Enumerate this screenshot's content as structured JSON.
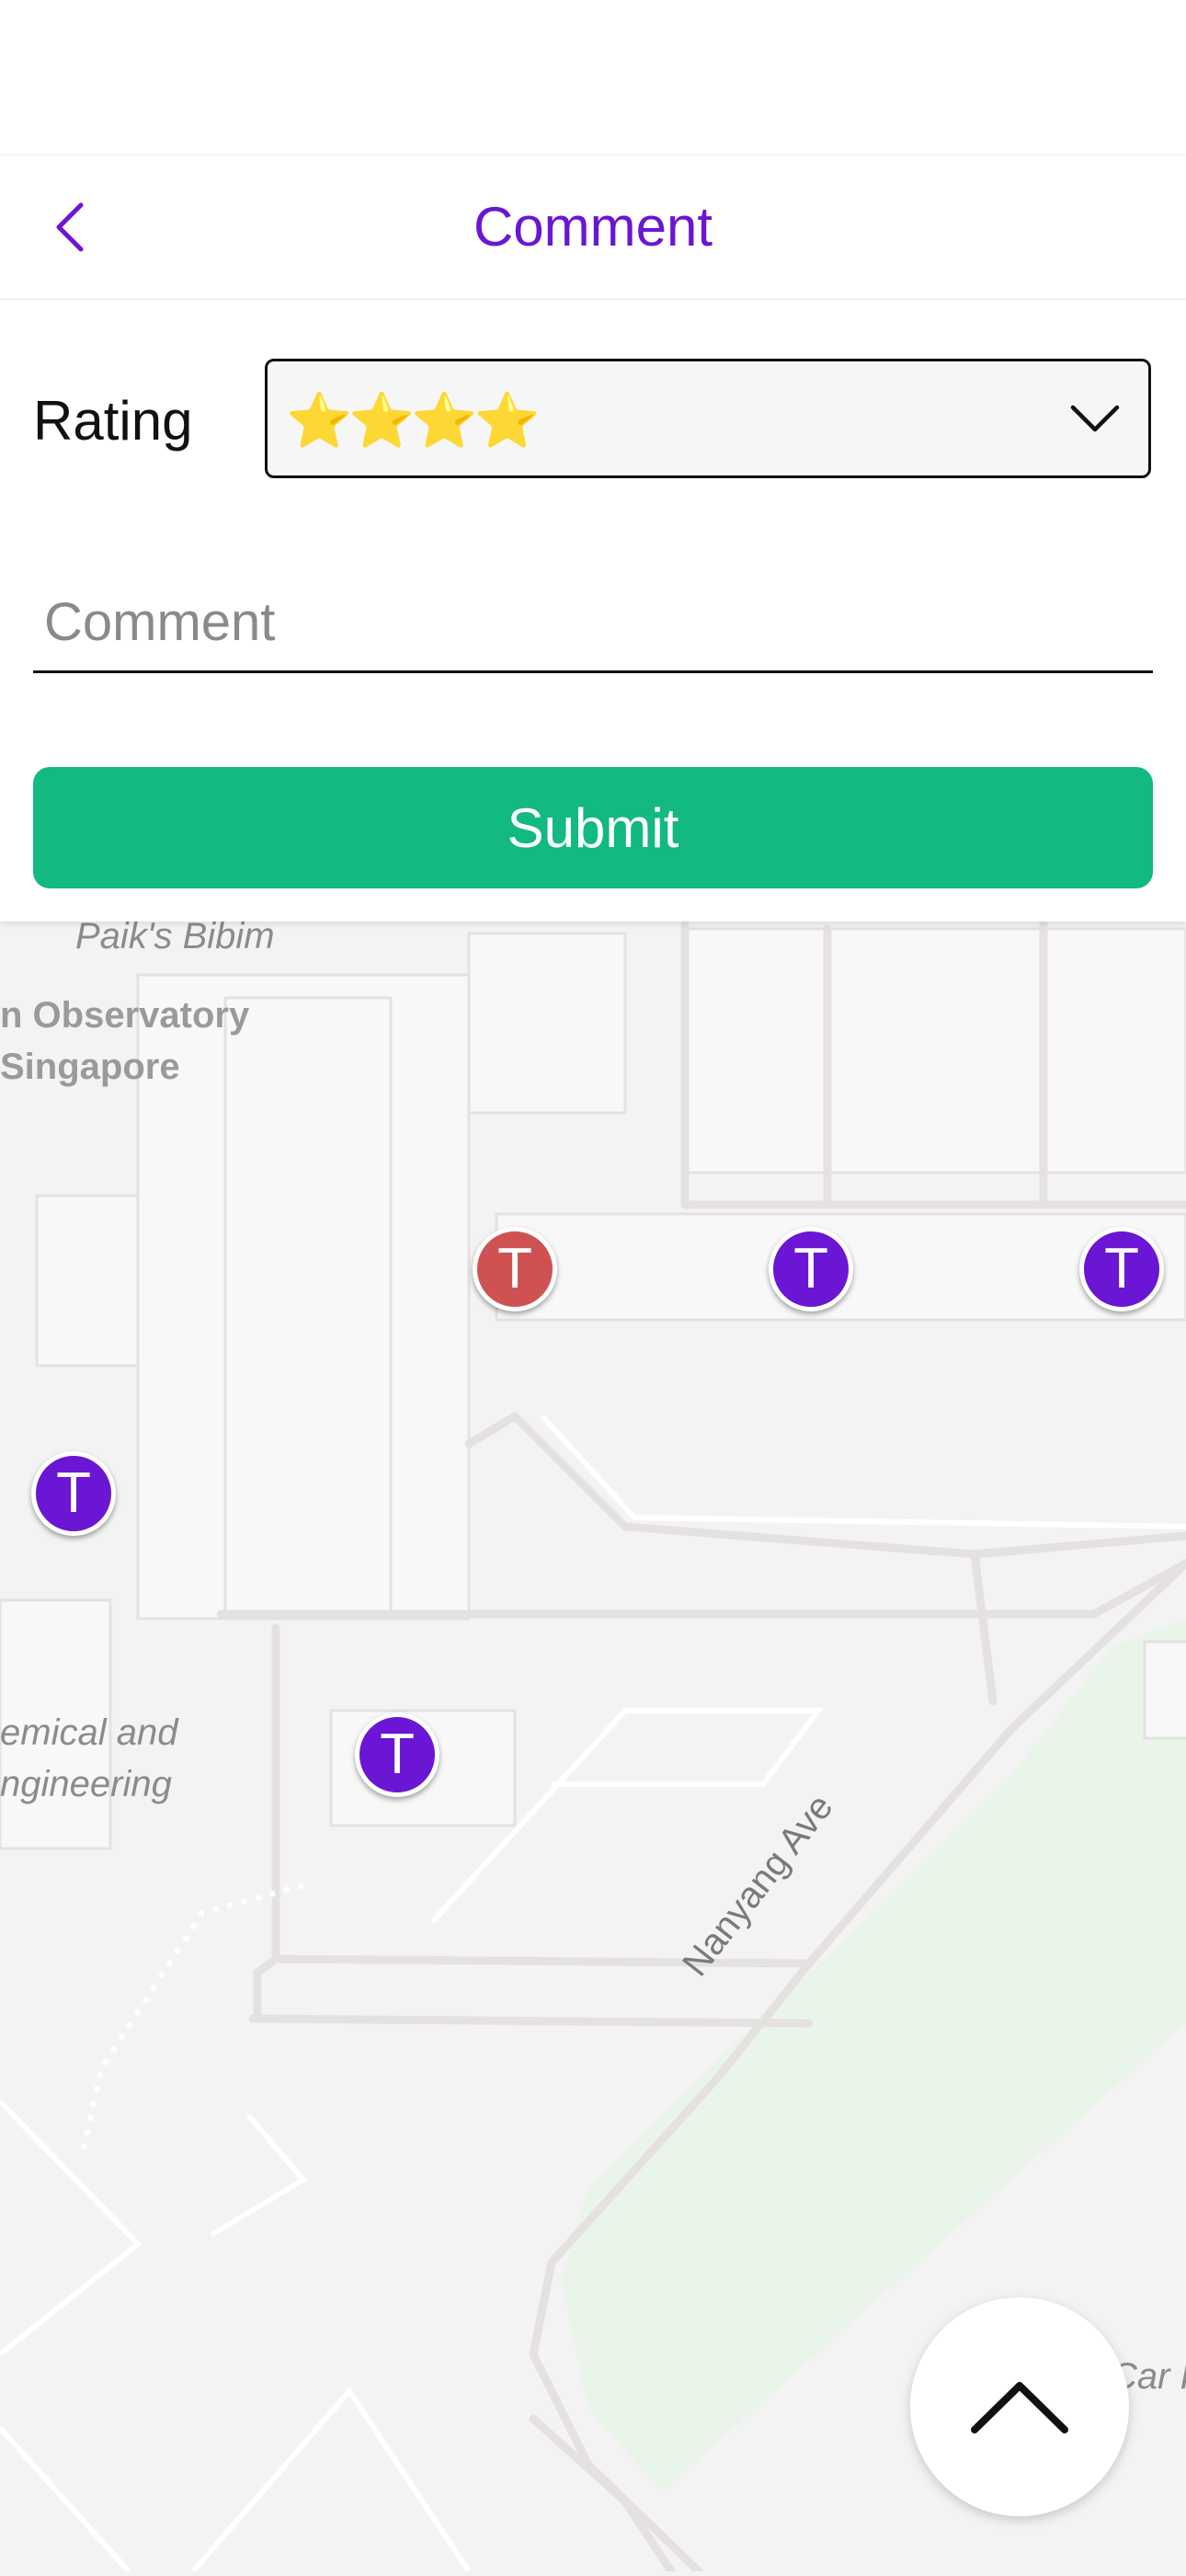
{
  "header": {
    "title": "Comment",
    "back_icon": "chevron-left-icon"
  },
  "form": {
    "rating_label": "Rating",
    "rating_value": "⭐⭐⭐⭐",
    "rating_dropdown_icon": "chevron-down-icon",
    "comment_placeholder": "Comment",
    "comment_value": "",
    "submit_label": "Submit"
  },
  "map": {
    "labels": [
      "Paik's Bibim",
      "n Observatory",
      "Singapore",
      "emical and",
      "ngineering",
      "Nanyang Ave",
      "Car P"
    ],
    "markers": [
      {
        "letter": "T",
        "color": "#cf5252"
      },
      {
        "letter": "T",
        "color": "#6a16d4"
      },
      {
        "letter": "T",
        "color": "#6a16d4"
      },
      {
        "letter": "T",
        "color": "#6a16d4"
      },
      {
        "letter": "T",
        "color": "#6a16d4"
      }
    ]
  },
  "fab": {
    "icon": "chevron-up-icon"
  },
  "colors": {
    "accent": "#6a16d4",
    "submit": "#12b981",
    "marker_alt": "#cf5252"
  }
}
